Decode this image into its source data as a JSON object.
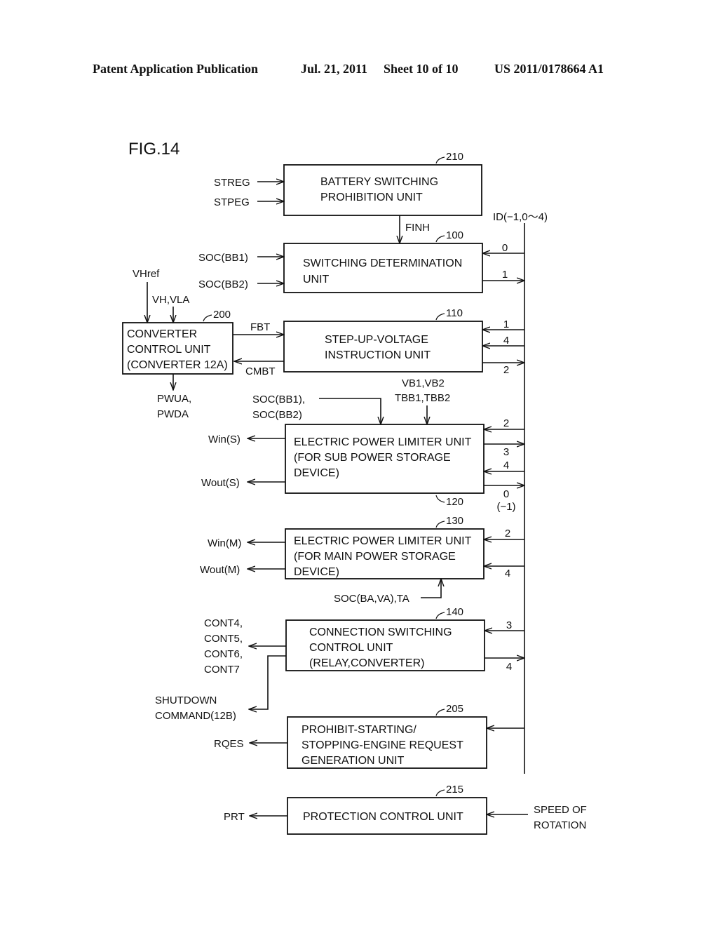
{
  "header": {
    "publication": "Patent Application Publication",
    "date": "Jul. 21, 2011",
    "sheet": "Sheet 10 of 10",
    "patent_number": "US 2011/0178664 A1"
  },
  "figure": {
    "label": "FIG.14",
    "bus_label": "ID(−1,0〜4)"
  },
  "blocks": [
    {
      "id": "210",
      "ref": "210",
      "lines": [
        "BATTERY SWITCHING",
        "PROHIBITION UNIT"
      ]
    },
    {
      "id": "100",
      "ref": "100",
      "lines": [
        "SWITCHING DETERMINATION",
        "UNIT"
      ]
    },
    {
      "id": "200",
      "ref": "200",
      "lines": [
        "CONVERTER",
        "CONTROL UNIT",
        "(CONVERTER 12A)"
      ]
    },
    {
      "id": "110",
      "ref": "110",
      "lines": [
        "STEP-UP-VOLTAGE",
        "INSTRUCTION UNIT"
      ]
    },
    {
      "id": "120",
      "ref": "120",
      "lines": [
        "ELECTRIC POWER LIMITER UNIT",
        "(FOR SUB POWER STORAGE",
        " DEVICE)"
      ]
    },
    {
      "id": "130",
      "ref": "130",
      "lines": [
        "ELECTRIC POWER LIMITER UNIT",
        "(FOR MAIN POWER STORAGE",
        "DEVICE)"
      ]
    },
    {
      "id": "140",
      "ref": "140",
      "lines": [
        "CONNECTION SWITCHING",
        "CONTROL UNIT",
        " (RELAY,CONVERTER)"
      ]
    },
    {
      "id": "205",
      "ref": "205",
      "lines": [
        "PROHIBIT-STARTING/",
        "STOPPING-ENGINE REQUEST",
        "GENERATION UNIT"
      ]
    },
    {
      "id": "215",
      "ref": "215",
      "lines": [
        "PROTECTION CONTROL UNIT"
      ]
    }
  ],
  "signals": {
    "streg": "STREG",
    "stpeg": "STPEG",
    "finh": "FINH",
    "soc_bb1": "SOC(BB1)",
    "soc_bb2": "SOC(BB2)",
    "vhref": "VHref",
    "vh_vla": "VH,VLA",
    "fbt": "FBT",
    "cmbt": "CMBT",
    "pwua": "PWUA,",
    "pwda": "PWDA",
    "soc_bb1_comma": "SOC(BB1),",
    "soc_bb2_b": "SOC(BB2)",
    "vb": "VB1,VB2",
    "tbb": "TBB1,TBB2",
    "win_s": "Win(S)",
    "wout_s": "Wout(S)",
    "win_m": "Win(M)",
    "wout_m": "Wout(M)",
    "soc_ba": "SOC(BA,VA),TA",
    "cont4": "CONT4,",
    "cont5": "CONT5,",
    "cont6": "CONT6,",
    "cont7": "CONT7",
    "shutdown1": "SHUTDOWN",
    "shutdown2": "COMMAND(12B)",
    "rqes": "RQES",
    "prt": "PRT",
    "speed1": "SPEED OF",
    "speed2": "ROTATION"
  },
  "bus_links": [
    {
      "block": "100",
      "value": "0",
      "direction": "to-block"
    },
    {
      "block": "100",
      "value": "1",
      "direction": "to-bus"
    },
    {
      "block": "110",
      "value": "1",
      "direction": "to-block"
    },
    {
      "block": "110",
      "value": "4",
      "direction": "to-block"
    },
    {
      "block": "110",
      "value": "2",
      "direction": "to-bus"
    },
    {
      "block": "120",
      "value": "2",
      "direction": "to-block"
    },
    {
      "block": "120",
      "value": "3",
      "direction": "to-bus"
    },
    {
      "block": "120",
      "value": "4",
      "direction": "to-block"
    },
    {
      "block": "120",
      "value": "0 (−1)",
      "direction": "to-bus"
    },
    {
      "block": "130",
      "value": "2",
      "direction": "to-block"
    },
    {
      "block": "130",
      "value": "4",
      "direction": "to-block"
    },
    {
      "block": "140",
      "value": "3",
      "direction": "to-block"
    },
    {
      "block": "140",
      "value": "4",
      "direction": "to-bus"
    },
    {
      "block": "205",
      "value": "",
      "direction": "to-block"
    }
  ],
  "bus_values": {
    "b100_0": "0",
    "b100_1": "1",
    "b110_1": "1",
    "b110_4": "4",
    "b110_2": "2",
    "b120_2": "2",
    "b120_3": "3",
    "b120_4": "4",
    "b120_0": "0",
    "b120_m1": "(−1)",
    "b130_2": "2",
    "b130_4": "4",
    "b140_3": "3",
    "b140_4": "4"
  }
}
